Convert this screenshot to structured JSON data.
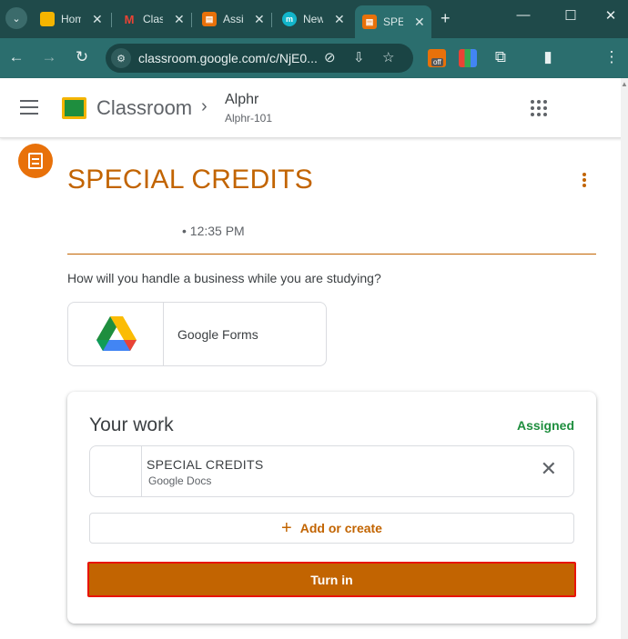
{
  "browser": {
    "tabs": [
      {
        "title": "Hom",
        "icon": "classroom-icon",
        "color": "#f4b400"
      },
      {
        "title": "Clas",
        "icon": "gmail-icon",
        "color": "#ffffff"
      },
      {
        "title": "Assi",
        "icon": "assignment-icon",
        "color": "#e8710a"
      },
      {
        "title": "New",
        "icon": "meet-icon",
        "color": "#12b5cb"
      },
      {
        "title": "SPE",
        "icon": "assignment-icon",
        "color": "#e8710a",
        "active": true
      }
    ],
    "url": "classroom.google.com/c/NjE0...",
    "ext_badge": "off"
  },
  "header": {
    "app_name": "Classroom",
    "class_name": "Alphr",
    "class_code": "Alphr-101"
  },
  "assignment": {
    "title": "SPECIAL CREDITS",
    "time": "• 12:35 PM",
    "instructions": "How will you handle a business while you are studying?",
    "attachment": {
      "label": "Google Forms",
      "icon": "google-drive-icon"
    }
  },
  "your_work": {
    "title": "Your work",
    "status": "Assigned",
    "submission": {
      "title": "SPECIAL CREDITS",
      "type": "Google Docs"
    },
    "add_label": "Add or create",
    "turn_in_label": "Turn in"
  },
  "colors": {
    "accent": "#c26401",
    "status_green": "#1e8e3e",
    "chrome": "#2b6e6e",
    "highlight_border": "#e8140a"
  }
}
